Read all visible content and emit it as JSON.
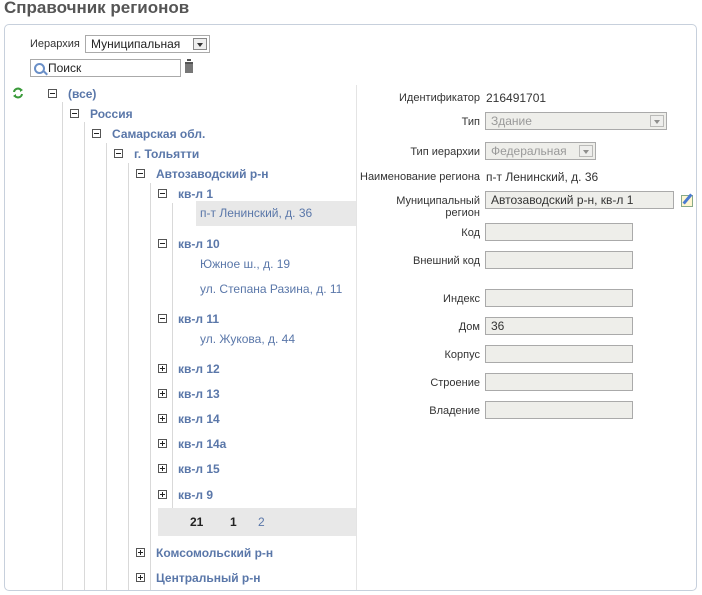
{
  "title": "Справочник регионов",
  "toolbar": {
    "hierarchy_label": "Иерархия",
    "hierarchy_value": "Муниципальная",
    "search_placeholder": "Поиск"
  },
  "tree": {
    "all": "(все)",
    "russia": "Россия",
    "samara": "Самарская обл.",
    "tolyatti": "г. Тольятти",
    "avtozavod": "Автозаводский р-н",
    "kvl1": "кв-л 1",
    "kvl1_items": [
      "п-т Ленинский, д. 36"
    ],
    "kvl10": "кв-л 10",
    "kvl10_items": [
      "Южное ш., д. 19",
      "ул. Степана Разина, д. 11"
    ],
    "kvl11": "кв-л 11",
    "kvl11_items": [
      "ул. Жукова, д. 44"
    ],
    "collapsed": [
      "кв-л 12",
      "кв-л 13",
      "кв-л 14",
      "кв-л 14а",
      "кв-л 15",
      "кв-л 9"
    ],
    "pager": {
      "first": "21",
      "current": "1",
      "next": "2"
    },
    "districts": [
      "Комсомольский р-н",
      "Центральный р-н"
    ]
  },
  "details": {
    "id_label": "Идентификатор",
    "id_value": "216491701",
    "type_label": "Тип",
    "type_value": "Здание",
    "hier_type_label": "Тип иерархии",
    "hier_type_value": "Федеральная",
    "name_label": "Наименование региона",
    "name_value": "п-т Ленинский, д. 36",
    "muni_label": "Муниципальный регион",
    "muni_value": "Автозаводский р-н, кв-л 1",
    "code_label": "Код",
    "code_value": "",
    "ext_code_label": "Внешний код",
    "ext_code_value": "",
    "index_label": "Индекс",
    "index_value": "",
    "house_label": "Дом",
    "house_value": "36",
    "korpus_label": "Корпус",
    "korpus_value": "",
    "building_label": "Строение",
    "building_value": "",
    "possession_label": "Владение",
    "possession_value": ""
  }
}
